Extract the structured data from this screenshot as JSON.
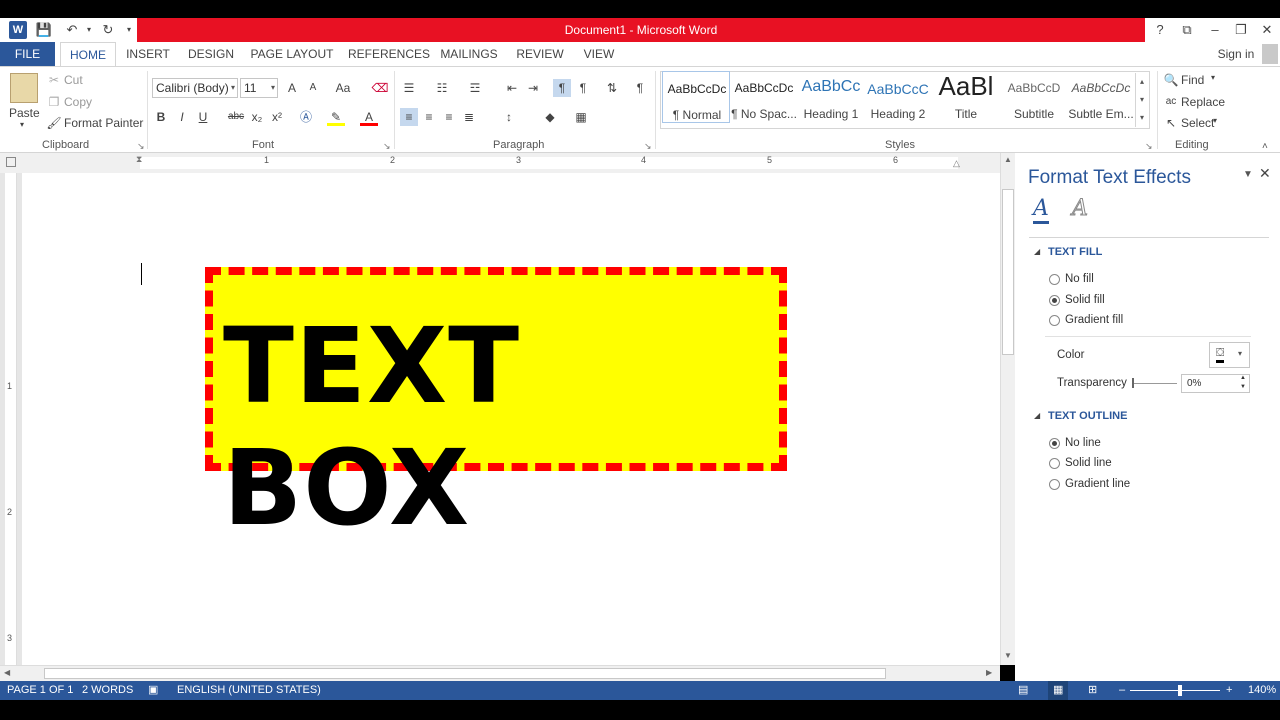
{
  "title": "Document1 -  Microsoft Word",
  "window": {
    "help": "?",
    "signin": "Sign in"
  },
  "tabs": [
    "FILE",
    "HOME",
    "INSERT",
    "DESIGN",
    "PAGE LAYOUT",
    "REFERENCES",
    "MAILINGS",
    "REVIEW",
    "VIEW"
  ],
  "clipboard": {
    "paste": "Paste",
    "cut": "Cut",
    "copy": "Copy",
    "format_painter": "Format Painter",
    "label": "Clipboard"
  },
  "font": {
    "name": "Calibri (Body)",
    "size": "11",
    "label": "Font",
    "bold": "B",
    "italic": "I",
    "underline": "U",
    "strike": "abc",
    "sub": "x₂",
    "sup": "x²",
    "grow": "A",
    "shrink": "A",
    "case": "Aa"
  },
  "paragraph": {
    "label": "Paragraph",
    "pilcrow": "¶"
  },
  "styles": {
    "label": "Styles",
    "items": [
      {
        "preview": "AaBbCcDc",
        "name": "¶ Normal"
      },
      {
        "preview": "AaBbCcDc",
        "name": "¶ No Spac..."
      },
      {
        "preview": "AaBbCc",
        "name": "Heading 1"
      },
      {
        "preview": "AaBbCcC",
        "name": "Heading 2"
      },
      {
        "preview": "AaBl",
        "name": "Title"
      },
      {
        "preview": "AaBbCcD",
        "name": "Subtitle"
      },
      {
        "preview": "AaBbCcDc",
        "name": "Subtle Em..."
      }
    ]
  },
  "editing": {
    "find": "Find",
    "replace": "Replace",
    "select": "Select",
    "label": "Editing"
  },
  "ruler": {
    "h": [
      "1",
      "2",
      "3",
      "4",
      "5",
      "6"
    ],
    "v": [
      "1",
      "2",
      "3"
    ]
  },
  "document": {
    "textbox_text": "TEXT BOX"
  },
  "pane": {
    "title": "Format Text Effects",
    "text_fill": {
      "header": "TEXT FILL",
      "options": [
        {
          "label": "No fill",
          "checked": false
        },
        {
          "label": "Solid fill",
          "checked": true
        },
        {
          "label": "Gradient fill",
          "checked": false
        }
      ],
      "color_label": "Color",
      "transparency_label": "Transparency",
      "transparency_value": "0%"
    },
    "text_outline": {
      "header": "TEXT OUTLINE",
      "options": [
        {
          "label": "No line",
          "checked": true
        },
        {
          "label": "Solid line",
          "checked": false
        },
        {
          "label": "Gradient line",
          "checked": false
        }
      ]
    }
  },
  "status": {
    "page": "PAGE 1 OF 1",
    "words": "2 WORDS",
    "language": "ENGLISH (UNITED STATES)",
    "zoom": "140%"
  },
  "colors": {
    "brand": "#2b579a",
    "titlebar": "#e81123",
    "textbox_fill": "#ffff00",
    "textbox_border": "#ff0000"
  }
}
